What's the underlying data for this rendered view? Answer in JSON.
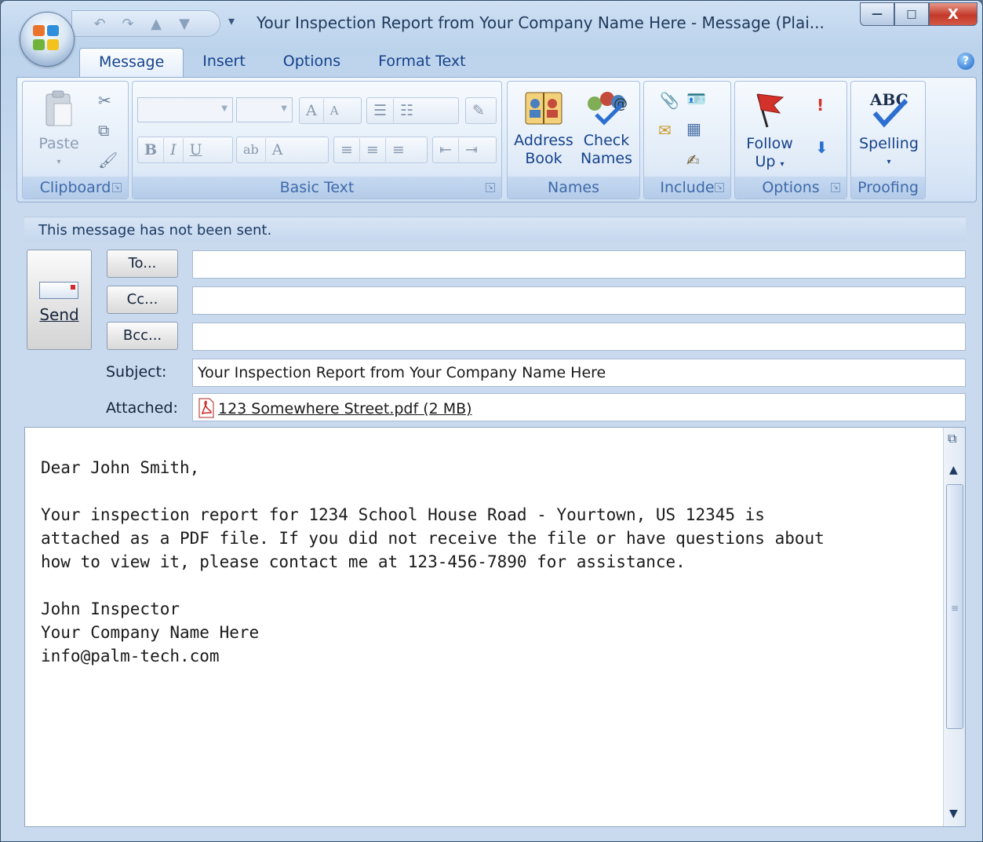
{
  "window": {
    "title": "Your Inspection Report from Your Company Name Here - Message (Plai...",
    "controls": {
      "minimize": "—",
      "maximize": "□",
      "close": "X"
    }
  },
  "quick_access": {
    "undo": "↶",
    "redo": "↷",
    "up": "▲",
    "down": "▼",
    "dropdown": "▾"
  },
  "tabs": [
    "Message",
    "Insert",
    "Options",
    "Format Text"
  ],
  "ribbon": {
    "clipboard": {
      "label": "Clipboard",
      "paste": "Paste"
    },
    "basic_text": {
      "label": "Basic Text",
      "bold": "B",
      "italic": "I",
      "underline": "U",
      "highlight": "ab",
      "font_color": "A",
      "grow": "A",
      "shrink": "A"
    },
    "names": {
      "label": "Names",
      "address_book_1": "Address",
      "address_book_2": "Book",
      "check_names_1": "Check",
      "check_names_2": "Names"
    },
    "include": {
      "label": "Include"
    },
    "options": {
      "label": "Options",
      "follow_up_1": "Follow",
      "follow_up_2": "Up"
    },
    "proofing": {
      "label": "Proofing",
      "spelling": "Spelling",
      "abc": "ABC"
    }
  },
  "message": {
    "info": "This message has not been sent.",
    "send_label": "Send",
    "to_label": "To...",
    "cc_label": "Cc...",
    "bcc_label": "Bcc...",
    "to_value": "",
    "cc_value": "",
    "bcc_value": "",
    "subject_label": "Subject:",
    "subject_value": "Your Inspection Report from Your Company Name Here",
    "attached_label": "Attached:",
    "attachment": "123 Somewhere Street.pdf (2 MB)",
    "body": "Dear John Smith,\n\nYour inspection report for 1234 School House Road - Yourtown, US 12345 is\nattached as a PDF file. If you did not receive the file or have questions about\nhow to view it, please contact me at 123-456-7890 for assistance.\n\nJohn Inspector\nYour Company Name Here\ninfo@palm-tech.com"
  }
}
